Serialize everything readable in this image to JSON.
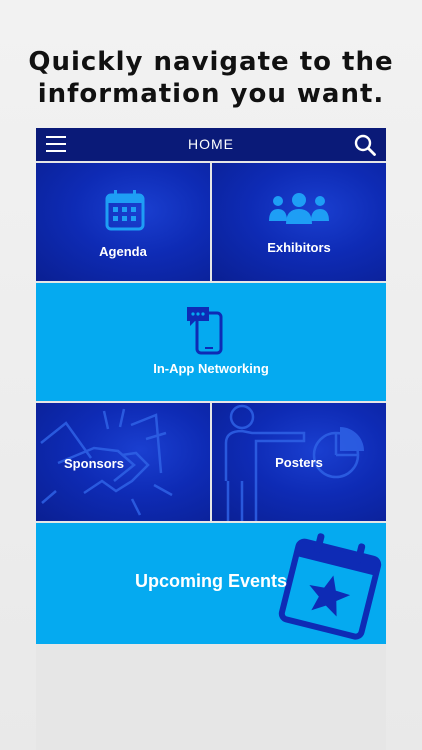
{
  "promo": {
    "headline": "Quickly navigate to the\ninformation you want."
  },
  "topbar": {
    "title": "HOME",
    "menu_icon": "hamburger-menu-icon",
    "search_icon": "search-icon"
  },
  "tiles": {
    "agenda": {
      "label": "Agenda",
      "icon": "calendar-icon"
    },
    "exhibitors": {
      "label": "Exhibitors",
      "icon": "people-group-icon"
    },
    "networking": {
      "label": "In-App Networking",
      "icon": "phone-chat-icon"
    },
    "sponsors": {
      "label": "Sponsors",
      "icon": "handshake-icon"
    },
    "posters": {
      "label": "Posters",
      "icon": "presenter-chart-icon"
    },
    "upcoming": {
      "label": "Upcoming Events",
      "icon": "calendar-star-icon"
    }
  },
  "colors": {
    "topbar": "#0a1a78",
    "tile_dark": "#0e2bb5",
    "tile_light": "#05aaf0",
    "icon_accent": "#1e9ef5"
  }
}
